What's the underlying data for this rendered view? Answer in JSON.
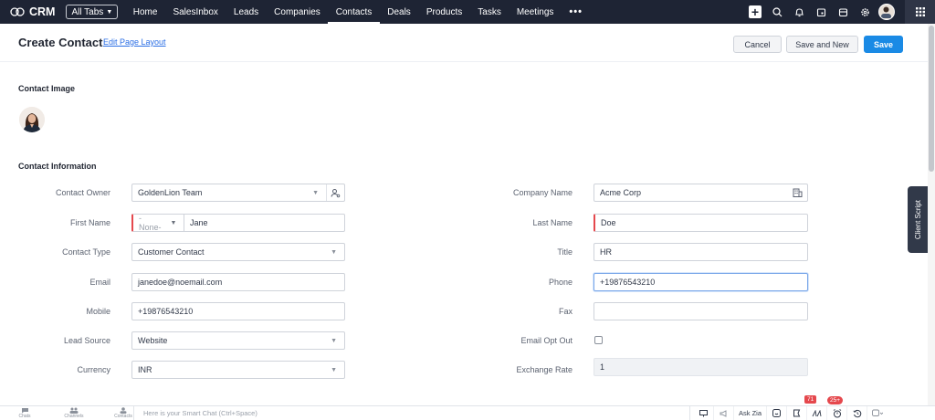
{
  "topnav": {
    "brand": "CRM",
    "all_tabs": "All Tabs",
    "tabs": [
      {
        "label": "Home"
      },
      {
        "label": "SalesInbox"
      },
      {
        "label": "Leads"
      },
      {
        "label": "Companies"
      },
      {
        "label": "Contacts",
        "active": true
      },
      {
        "label": "Deals"
      },
      {
        "label": "Products"
      },
      {
        "label": "Tasks"
      },
      {
        "label": "Meetings"
      },
      {
        "label": "•••"
      }
    ],
    "icons": [
      "add-icon",
      "search-icon",
      "bell-icon",
      "calendar-icon",
      "marketplace-icon",
      "settings-icon",
      "avatar",
      "apps-grid-icon"
    ]
  },
  "header": {
    "title": "Create Contact",
    "edit_layout": "Edit Page Layout",
    "cancel": "Cancel",
    "save_and_new": "Save and New",
    "save": "Save"
  },
  "sections": {
    "contact_image": "Contact Image",
    "contact_information": "Contact Information"
  },
  "fields": {
    "contact_owner": {
      "label": "Contact Owner",
      "value": "GoldenLion Team"
    },
    "first_name": {
      "label": "First Name",
      "salutation": "-None-",
      "value": "Jane"
    },
    "contact_type": {
      "label": "Contact Type",
      "value": "Customer Contact"
    },
    "email": {
      "label": "Email",
      "value": "janedoe@noemail.com"
    },
    "mobile": {
      "label": "Mobile",
      "value": "+19876543210"
    },
    "lead_source": {
      "label": "Lead Source",
      "value": "Website"
    },
    "currency": {
      "label": "Currency",
      "value": "INR"
    },
    "company_name": {
      "label": "Company Name",
      "value": "Acme Corp"
    },
    "last_name": {
      "label": "Last Name",
      "value": "Doe"
    },
    "title": {
      "label": "Title",
      "value": "HR"
    },
    "phone": {
      "label": "Phone",
      "value": "+19876543210"
    },
    "fax": {
      "label": "Fax",
      "value": ""
    },
    "email_opt_out": {
      "label": "Email Opt Out",
      "checked": false
    },
    "exchange_rate": {
      "label": "Exchange Rate",
      "value": "1"
    }
  },
  "client_script": "Client Script",
  "bottombar": {
    "items": [
      {
        "label": "Chats"
      },
      {
        "label": "Channels"
      },
      {
        "label": "Contacts"
      }
    ],
    "smart_chat_placeholder": "Here is your Smart Chat (Ctrl+Space)",
    "ask_zia": "Ask Zia",
    "badge_71": "71",
    "badge_25": "25+"
  },
  "colors": {
    "nav_bg": "#1e2434",
    "primary": "#1a8ae5",
    "link": "#2a6ee5",
    "required": "#e5484d"
  }
}
